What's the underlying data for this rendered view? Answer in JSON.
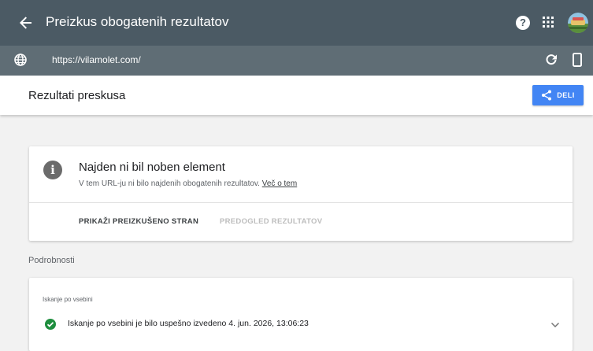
{
  "appbar": {
    "title": "Preizkus obogatenih rezultatov",
    "help_glyph": "?",
    "icons": [
      "back-arrow-icon",
      "help-icon",
      "apps-grid-icon",
      "avatar"
    ]
  },
  "urlbar": {
    "url": "https://vilamolet.com/",
    "icons": [
      "globe-icon",
      "reload-icon",
      "mobile-device-icon"
    ]
  },
  "results": {
    "title": "Rezultati preskusa",
    "share_label": "DELI"
  },
  "card": {
    "info_glyph": "i",
    "title": "Najden ni bil noben element",
    "description": "V tem URL-ju ni bilo najdenih obogatenih rezultatov.",
    "link_text": "Več o tem",
    "action_primary": "PRIKAŽI PREIZKUŠENO STRAN",
    "action_disabled": "PREDOGLED REZULTATOV"
  },
  "details": {
    "label": "Podrobnosti",
    "section_label": "Iskanje po vsebini",
    "status": "Iskanje po vsebini je bilo uspešno izvedeno 4. jun. 2026, 13:06:23"
  },
  "colors": {
    "appbar": "#4b5a64",
    "urlbar": "#5f6d75",
    "accent": "#4285f4",
    "success": "#1e8e3e",
    "background": "#f2f2f2"
  }
}
